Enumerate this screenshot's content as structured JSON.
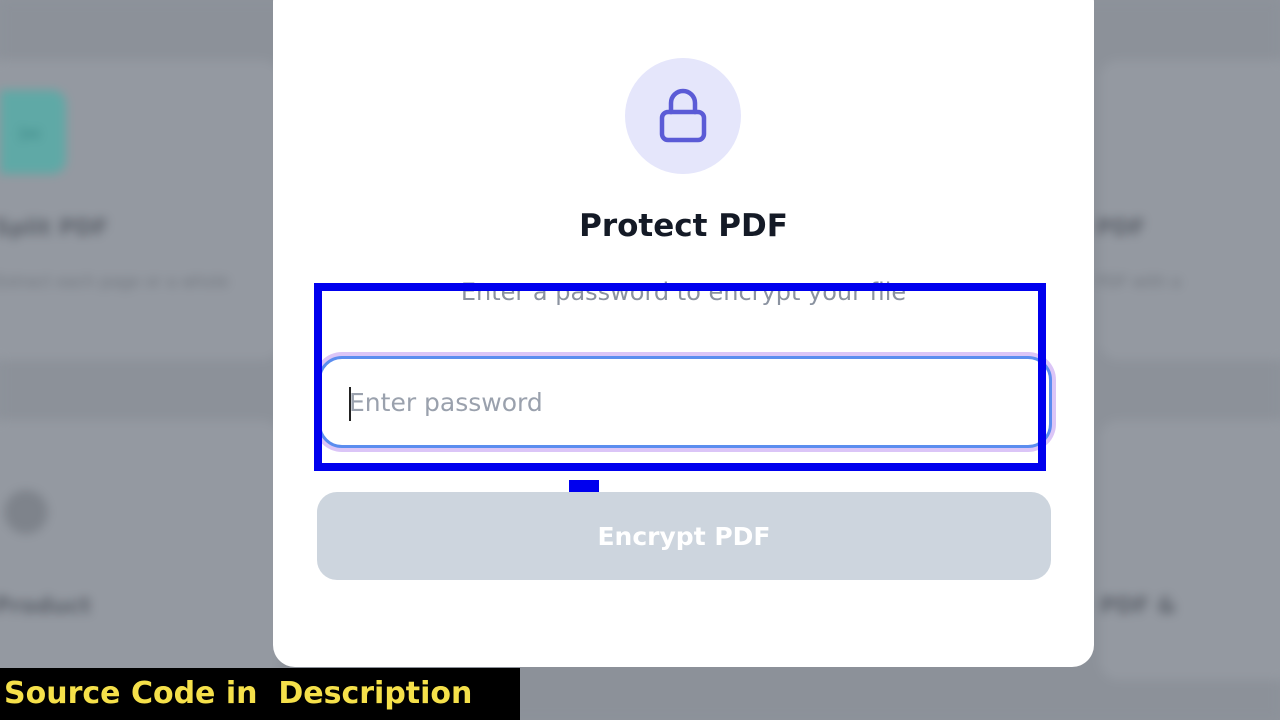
{
  "background": {
    "left_card_title": "Split PDF",
    "left_card_desc_1": "Extract each page or a whole",
    "left_card_desc_2": "",
    "right_card_title": "PDF",
    "right_card_desc": "PDF with a",
    "left_card2_title": "Product",
    "right_card2_title": "PDF &"
  },
  "modal": {
    "icon": "lock-icon",
    "title": "Protect PDF",
    "subtitle": "Enter a password to encrypt your file",
    "password_field": {
      "placeholder": "Enter password",
      "value": ""
    },
    "encrypt_button_label": "Encrypt PDF"
  },
  "caption": {
    "text": "Source Code in  Description"
  },
  "colors": {
    "accent": "#5b5bd6",
    "lock_badge_bg": "#e5e6fb",
    "button_disabled_bg": "#cdd5de",
    "highlight": "#0000ee",
    "caption_text": "#f5e04a"
  }
}
